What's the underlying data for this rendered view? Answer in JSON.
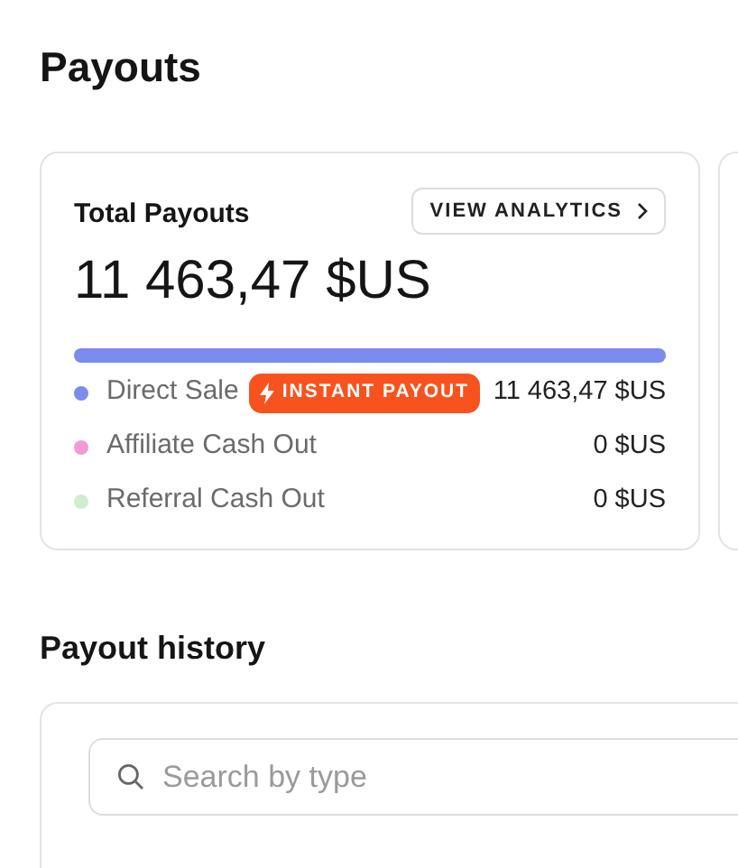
{
  "page_title": "Payouts",
  "total_card": {
    "title": "Total Payouts",
    "analytics_button": "VIEW ANALYTICS",
    "amount": "11 463,47 $US",
    "bar": {
      "level": 1
    },
    "breakdown": [
      {
        "label": "Direct Sale",
        "color": "#7b8cee",
        "badge": "INSTANT PAYOUT",
        "amount": "11 463,47 $US"
      },
      {
        "label": "Affiliate Cash Out",
        "color": "#f29ad8",
        "amount": "0 $US"
      },
      {
        "label": "Referral Cash Out",
        "color": "#cdeecf",
        "amount": "0 $US"
      }
    ]
  },
  "history": {
    "title": "Payout history",
    "search": {
      "placeholder": "Search by type"
    }
  }
}
